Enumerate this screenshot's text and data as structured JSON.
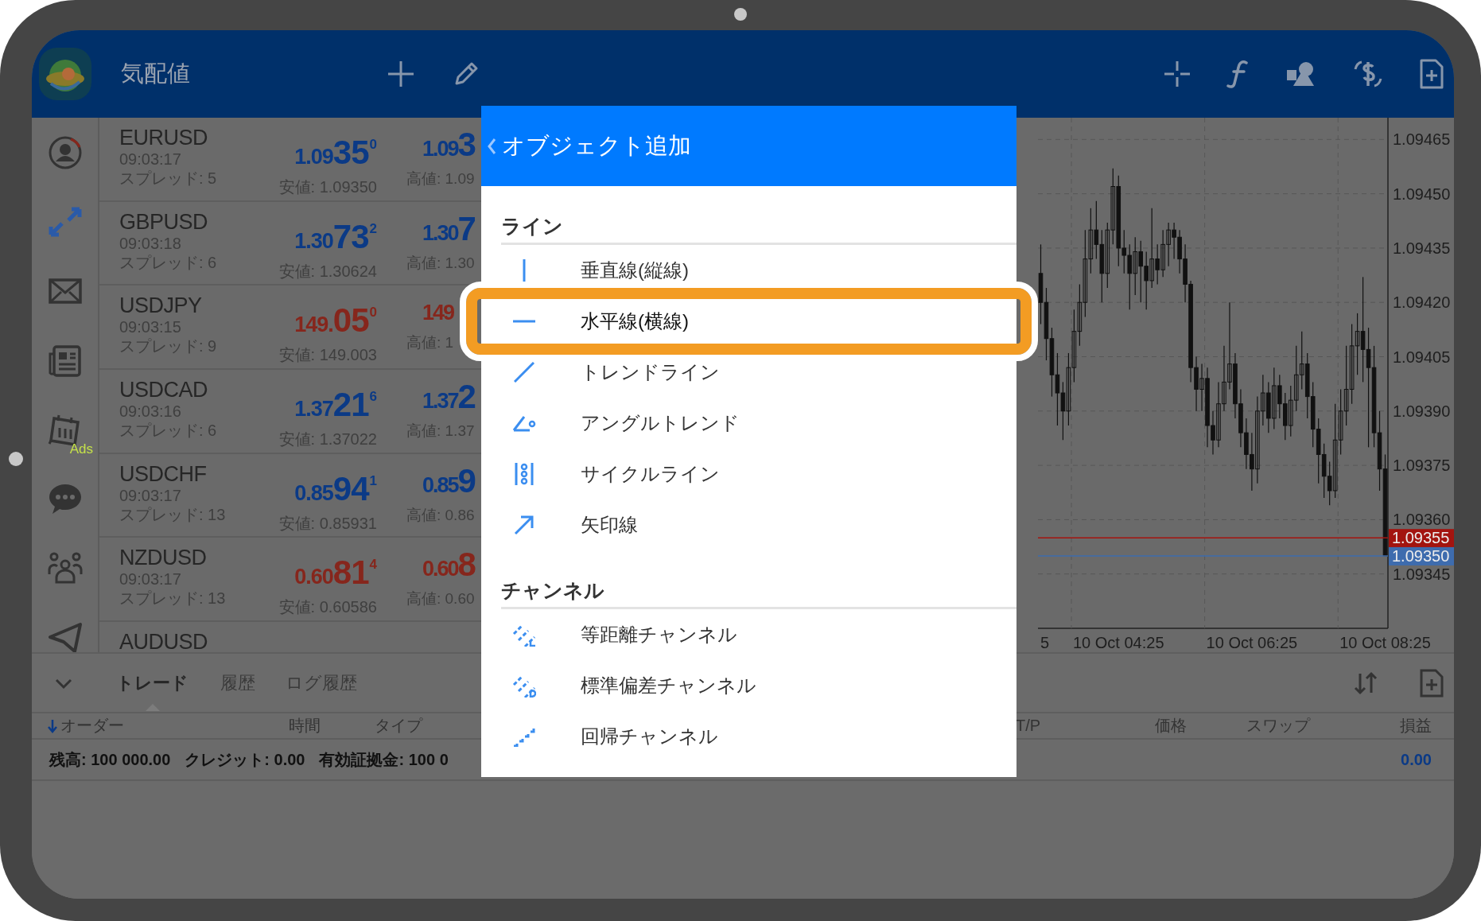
{
  "top_bar": {
    "title": "気配値"
  },
  "sidebar": {
    "items": [
      {
        "selected": false
      },
      {
        "selected": true
      },
      {
        "selected": false
      },
      {
        "selected": false
      },
      {
        "selected": false,
        "badge": "Ads"
      },
      {
        "selected": false
      },
      {
        "selected": false
      },
      {
        "selected": false
      }
    ]
  },
  "quotes": [
    {
      "symbol": "EURUSD",
      "time": "09:03:17",
      "spread": "スプレッド: 5",
      "color": "#0b3a86",
      "bid": {
        "lead": "1.09",
        "big": "35",
        "sup": "0"
      },
      "low": "安値: 1.09350",
      "ask": {
        "lead": "1.09",
        "big": "3"
      },
      "high": "高値: 1.09"
    },
    {
      "symbol": "GBPUSD",
      "time": "09:03:18",
      "spread": "スプレッド: 6",
      "color": "#0b3a86",
      "bid": {
        "lead": "1.30",
        "big": "73",
        "sup": "2"
      },
      "low": "安値: 1.30624",
      "ask": {
        "lead": "1.30",
        "big": "7"
      },
      "high": "高値: 1.30"
    },
    {
      "symbol": "USDJPY",
      "time": "09:03:15",
      "spread": "スプレッド: 9",
      "color": "#86261c",
      "bid": {
        "lead": "149.",
        "big": "05",
        "sup": "0"
      },
      "low": "安値: 149.003",
      "ask": {
        "lead": "149"
      },
      "high": "高値: 1"
    },
    {
      "symbol": "USDCAD",
      "time": "09:03:16",
      "spread": "スプレッド: 6",
      "color": "#0b3a86",
      "bid": {
        "lead": "1.37",
        "big": "21",
        "sup": "6"
      },
      "low": "安値: 1.37022",
      "ask": {
        "lead": "1.37",
        "big": "2"
      },
      "high": "高値: 1.37"
    },
    {
      "symbol": "USDCHF",
      "time": "09:03:17",
      "spread": "スプレッド: 13",
      "color": "#0b3a86",
      "bid": {
        "lead": "0.85",
        "big": "94",
        "sup": "1"
      },
      "low": "安値: 0.85931",
      "ask": {
        "lead": "0.85",
        "big": "9"
      },
      "high": "高値: 0.86"
    },
    {
      "symbol": "NZDUSD",
      "time": "09:03:17",
      "spread": "スプレッド: 13",
      "color": "#86261c",
      "bid": {
        "lead": "0.60",
        "big": "81",
        "sup": "4"
      },
      "low": "安値: 0.60586",
      "ask": {
        "lead": "0.60",
        "big": "8"
      },
      "high": "高値: 0.60"
    },
    {
      "symbol": "AUDUSD"
    }
  ],
  "chart": {
    "chart_data": {
      "type": "candlestick",
      "categories": [
        null,
        null,
        null,
        null,
        null,
        null,
        null,
        null,
        null,
        null,
        null,
        null,
        null,
        null,
        "10 Oct 04:25",
        null,
        null,
        null,
        null,
        null,
        null,
        null,
        null,
        null,
        null,
        null,
        null,
        null,
        null,
        null,
        null,
        null,
        null,
        null,
        null,
        null,
        null,
        null,
        "10 Oct 06:25",
        null,
        null,
        null,
        null,
        null,
        null,
        null,
        null,
        null,
        null,
        null,
        null,
        null,
        null,
        null,
        null,
        null,
        null,
        null,
        null,
        null,
        null,
        null,
        "10 Oct 08:25"
      ],
      "ohlc": [
        [
          1.09428,
          1.09436,
          1.09414,
          1.0942
        ],
        [
          1.0942,
          1.09424,
          1.09404,
          1.0941
        ],
        [
          1.0941,
          1.09413,
          1.09394,
          1.094
        ],
        [
          1.094,
          1.09406,
          1.09386,
          1.09395
        ],
        [
          1.09395,
          1.09398,
          1.09382,
          1.0939
        ],
        [
          1.0939,
          1.09406,
          1.09386,
          1.09402
        ],
        [
          1.09402,
          1.09418,
          1.09398,
          1.09412
        ],
        [
          1.09412,
          1.09425,
          1.09408,
          1.0942
        ],
        [
          1.0942,
          1.0944,
          1.09416,
          1.09432
        ],
        [
          1.09432,
          1.09446,
          1.09428,
          1.0944
        ],
        [
          1.0944,
          1.09448,
          1.09432,
          1.09436
        ],
        [
          1.09436,
          1.0944,
          1.0942,
          1.09428
        ],
        [
          1.09428,
          1.09442,
          1.09424,
          1.0944
        ],
        [
          1.0944,
          1.09457,
          1.09436,
          1.09452
        ],
        [
          1.09452,
          1.09455,
          1.0943,
          1.09435
        ],
        [
          1.09435,
          1.0944,
          1.09428,
          1.09433
        ],
        [
          1.09433,
          1.09436,
          1.09418,
          1.09428
        ],
        [
          1.09428,
          1.09438,
          1.09422,
          1.09434
        ],
        [
          1.09434,
          1.09437,
          1.0942,
          1.0943
        ],
        [
          1.0943,
          1.09434,
          1.09418,
          1.09426
        ],
        [
          1.09426,
          1.09446,
          1.09424,
          1.09432
        ],
        [
          1.09432,
          1.09436,
          1.09425,
          1.09429
        ],
        [
          1.09429,
          1.0944,
          1.09427,
          1.09436
        ],
        [
          1.09436,
          1.09442,
          1.0943,
          1.0944
        ],
        [
          1.0944,
          1.09442,
          1.09432,
          1.09438
        ],
        [
          1.09438,
          1.0944,
          1.09428,
          1.09432
        ],
        [
          1.09432,
          1.09436,
          1.0942,
          1.09425
        ],
        [
          1.09425,
          1.09426,
          1.09398,
          1.09402
        ],
        [
          1.09402,
          1.09405,
          1.0939,
          1.09396
        ],
        [
          1.09396,
          1.09403,
          1.0939,
          1.09399
        ],
        [
          1.09399,
          1.09402,
          1.0938,
          1.09386
        ],
        [
          1.09386,
          1.0939,
          1.09378,
          1.09382
        ],
        [
          1.09382,
          1.09398,
          1.0938,
          1.09392
        ],
        [
          1.09392,
          1.09408,
          1.0939,
          1.09398
        ],
        [
          1.09398,
          1.0942,
          1.09396,
          1.09403
        ],
        [
          1.09403,
          1.09406,
          1.09388,
          1.09392
        ],
        [
          1.09392,
          1.09396,
          1.0938,
          1.09384
        ],
        [
          1.09384,
          1.09388,
          1.09374,
          1.09378
        ],
        [
          1.09378,
          1.09384,
          1.09368,
          1.09374
        ],
        [
          1.09374,
          1.09394,
          1.0937,
          1.0939
        ],
        [
          1.0939,
          1.094,
          1.09386,
          1.09395
        ],
        [
          1.09395,
          1.09398,
          1.09384,
          1.09388
        ],
        [
          1.09388,
          1.09402,
          1.09385,
          1.09397
        ],
        [
          1.09397,
          1.094,
          1.09388,
          1.09392
        ],
        [
          1.09392,
          1.09395,
          1.09382,
          1.09386
        ],
        [
          1.09386,
          1.09397,
          1.09383,
          1.09393
        ],
        [
          1.09393,
          1.09408,
          1.0939,
          1.094
        ],
        [
          1.094,
          1.09412,
          1.09396,
          1.09403
        ],
        [
          1.09403,
          1.09406,
          1.09388,
          1.09394
        ],
        [
          1.09394,
          1.09398,
          1.0938,
          1.09385
        ],
        [
          1.09385,
          1.09388,
          1.0937,
          1.09378
        ],
        [
          1.09378,
          1.09381,
          1.09366,
          1.09372
        ],
        [
          1.09372,
          1.09376,
          1.09364,
          1.09368
        ],
        [
          1.09368,
          1.09392,
          1.09366,
          1.09382
        ],
        [
          1.09382,
          1.09396,
          1.09378,
          1.0939
        ],
        [
          1.0939,
          1.09408,
          1.09386,
          1.09396
        ],
        [
          1.09396,
          1.09414,
          1.09392,
          1.09408
        ],
        [
          1.09408,
          1.09417,
          1.094,
          1.09412
        ],
        [
          1.09412,
          1.09427,
          1.09398,
          1.09407
        ],
        [
          1.09407,
          1.09413,
          1.0938,
          1.09402
        ],
        [
          1.09402,
          1.09408,
          1.0938,
          1.09384
        ],
        [
          1.09384,
          1.0939,
          1.09368,
          1.09374
        ],
        [
          1.09374,
          1.09378,
          1.0935,
          1.0935
        ]
      ],
      "ylim": [
        1.0933,
        1.09471
      ],
      "yticks": [
        {
          "value": 1.09465,
          "label": "1.09465"
        },
        {
          "value": 1.0945,
          "label": "1.09450"
        },
        {
          "value": 1.09435,
          "label": "1.09435"
        },
        {
          "value": 1.0942,
          "label": "1.09420"
        },
        {
          "value": 1.09405,
          "label": "1.09405"
        },
        {
          "value": 1.0939,
          "label": "1.09390"
        },
        {
          "value": 1.09375,
          "label": "1.09375"
        },
        {
          "value": 1.0936,
          "label": "1.09360"
        },
        {
          "value": 1.09345,
          "label": "1.09345"
        }
      ],
      "grid": true,
      "ref_lines": [
        {
          "axis": "y",
          "value": 1.09355,
          "label": "1.09355",
          "color": "#a3140f"
        },
        {
          "axis": "y",
          "value": 1.0935,
          "label": "1.09350",
          "color": "#3e6cae"
        }
      ]
    },
    "axis_fragment": "5"
  },
  "bottom_panel": {
    "tabs": [
      {
        "label": "トレード",
        "selected": true
      },
      {
        "label": "履歴",
        "selected": false
      },
      {
        "label": "ログ履歴",
        "selected": false
      }
    ],
    "columns": [
      "オーダー",
      "時間",
      "タイプ",
      "T/P",
      "価格",
      "スワップ",
      "損益"
    ],
    "balance": [
      "残高: 100 000.00",
      "クレジット: 0.00",
      "有効証拠金: 100 0"
    ],
    "profit": "0.00"
  },
  "popup": {
    "title": "オブジェクト追加",
    "sections": [
      {
        "title": "ライン",
        "items": [
          {
            "label": "垂直線(縦線)",
            "selected": false
          },
          {
            "label": "水平線(横線)",
            "selected": true
          },
          {
            "label": "トレンドライン",
            "selected": false
          },
          {
            "label": "アングルトレンド",
            "selected": false
          },
          {
            "label": "サイクルライン",
            "selected": false
          },
          {
            "label": "矢印線",
            "selected": false
          }
        ]
      },
      {
        "title": "チャンネル",
        "items": [
          {
            "label": "等距離チャンネル",
            "selected": false
          },
          {
            "label": "標準偏差チャンネル",
            "selected": false
          },
          {
            "label": "回帰チャンネル",
            "selected": false
          }
        ]
      }
    ]
  }
}
